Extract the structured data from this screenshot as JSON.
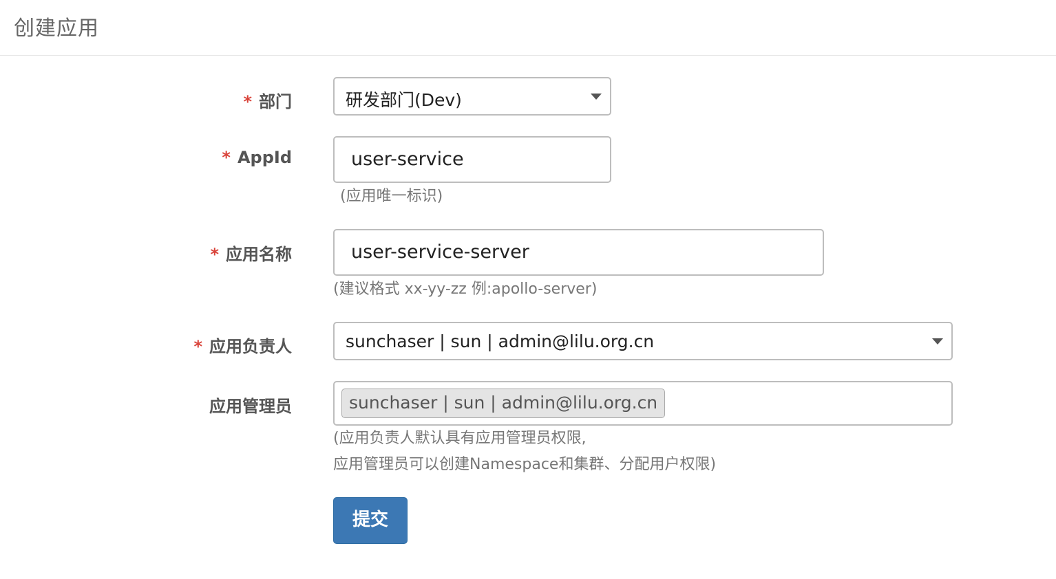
{
  "header": {
    "title": "创建应用"
  },
  "form": {
    "required_mark": "*",
    "department": {
      "label": "部门",
      "value": "研发部门(Dev)"
    },
    "appid": {
      "label": "AppId",
      "value": "user-service",
      "help": "(应用唯一标识)"
    },
    "app_name": {
      "label": "应用名称",
      "value": "user-service-server",
      "help": "(建议格式 xx-yy-zz 例:apollo-server)"
    },
    "owner": {
      "label": "应用负责人",
      "value": "sunchaser | sun | admin@lilu.org.cn"
    },
    "admins": {
      "label": "应用管理员",
      "tags": [
        "sunchaser | sun | admin@lilu.org.cn"
      ],
      "help_line1": "(应用负责人默认具有应用管理员权限,",
      "help_line2": "应用管理员可以创建Namespace和集群、分配用户权限)"
    },
    "submit_label": "提交"
  },
  "icons": {
    "select_caret": "chevron-down-icon"
  },
  "colors": {
    "primary_button": "#3c78b4",
    "required": "#d9433a"
  }
}
